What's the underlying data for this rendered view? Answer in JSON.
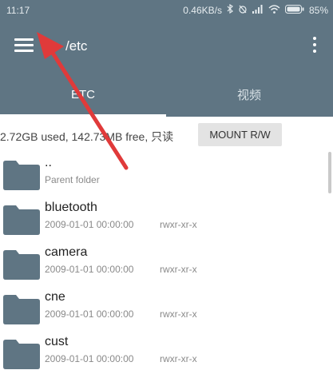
{
  "status_bar": {
    "time": "11:17",
    "net_speed": "0.46KB/s",
    "battery": "85%",
    "icons": [
      "bluetooth-icon",
      "alarm-icon",
      "signal-icon",
      "wifi-icon",
      "battery-icon"
    ]
  },
  "toolbar": {
    "path": "/etc",
    "menu_icon": "hamburger-menu-icon",
    "more_icon": "more-vert-icon"
  },
  "tabs": [
    {
      "label": "ETC",
      "active": true
    },
    {
      "label": "视频",
      "active": false
    }
  ],
  "storage": {
    "info": "2.72GB used, 142.73MB free, 只读",
    "mount_label": "MOUNT R/W"
  },
  "files": [
    {
      "name": "..",
      "subtitle": "Parent folder",
      "perms": ""
    },
    {
      "name": "bluetooth",
      "subtitle": "2009-01-01 00:00:00",
      "perms": "rwxr-xr-x"
    },
    {
      "name": "camera",
      "subtitle": "2009-01-01 00:00:00",
      "perms": "rwxr-xr-x"
    },
    {
      "name": "cne",
      "subtitle": "2009-01-01 00:00:00",
      "perms": "rwxr-xr-x"
    },
    {
      "name": "cust",
      "subtitle": "2009-01-01 00:00:00",
      "perms": "rwxr-xr-x"
    }
  ],
  "colors": {
    "toolbar_bg": "#5f7583",
    "folder_icon": "#5f7583",
    "annotation_arrow": "#e03a3a"
  }
}
